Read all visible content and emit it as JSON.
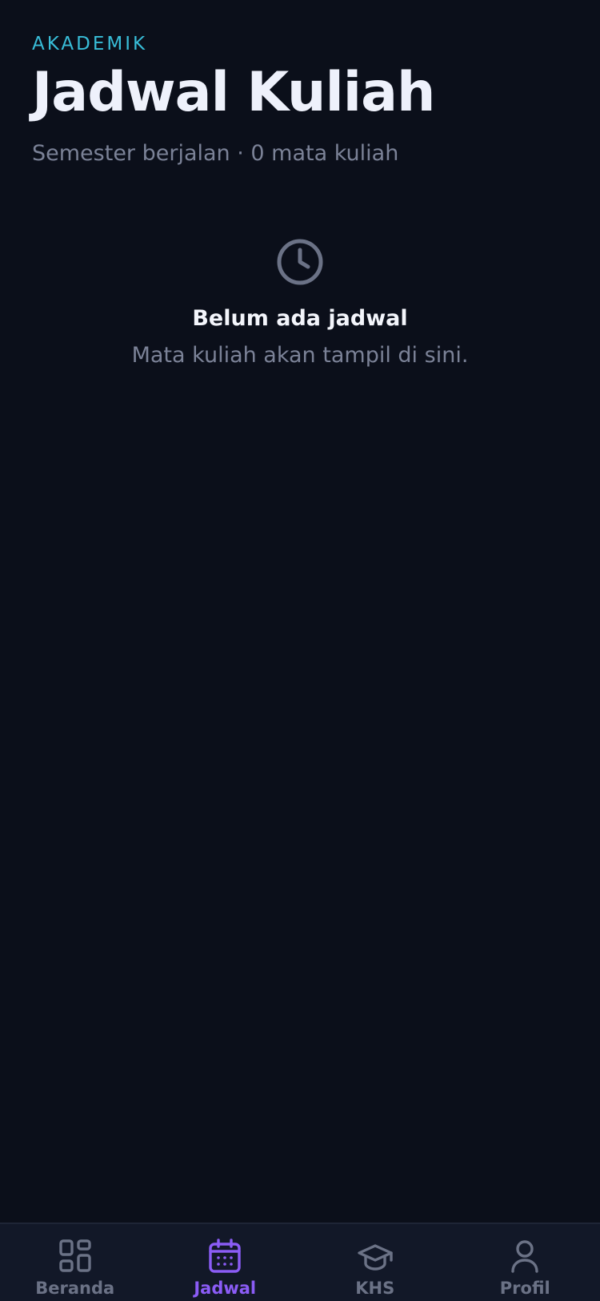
{
  "header": {
    "eyebrow": "AKADEMIK",
    "title": "Jadwal Kuliah",
    "subtitle": "Semester berjalan · 0 mata kuliah"
  },
  "empty_state": {
    "icon": "clock-icon",
    "title": "Belum ada jadwal",
    "message": "Mata kuliah akan tampil di sini."
  },
  "tabbar": {
    "items": [
      {
        "label": "Beranda",
        "icon": "grid-icon",
        "active": false
      },
      {
        "label": "Jadwal",
        "icon": "calendar-icon",
        "active": true
      },
      {
        "label": "KHS",
        "icon": "graduation-cap-icon",
        "active": false
      },
      {
        "label": "Profil",
        "icon": "user-icon",
        "active": false
      }
    ]
  },
  "colors": {
    "background": "#0b0f1a",
    "accent_cyan": "#38bdd8",
    "accent_purple": "#8b5cf6",
    "muted": "#7b8297",
    "tabbar_background": "#121828"
  }
}
